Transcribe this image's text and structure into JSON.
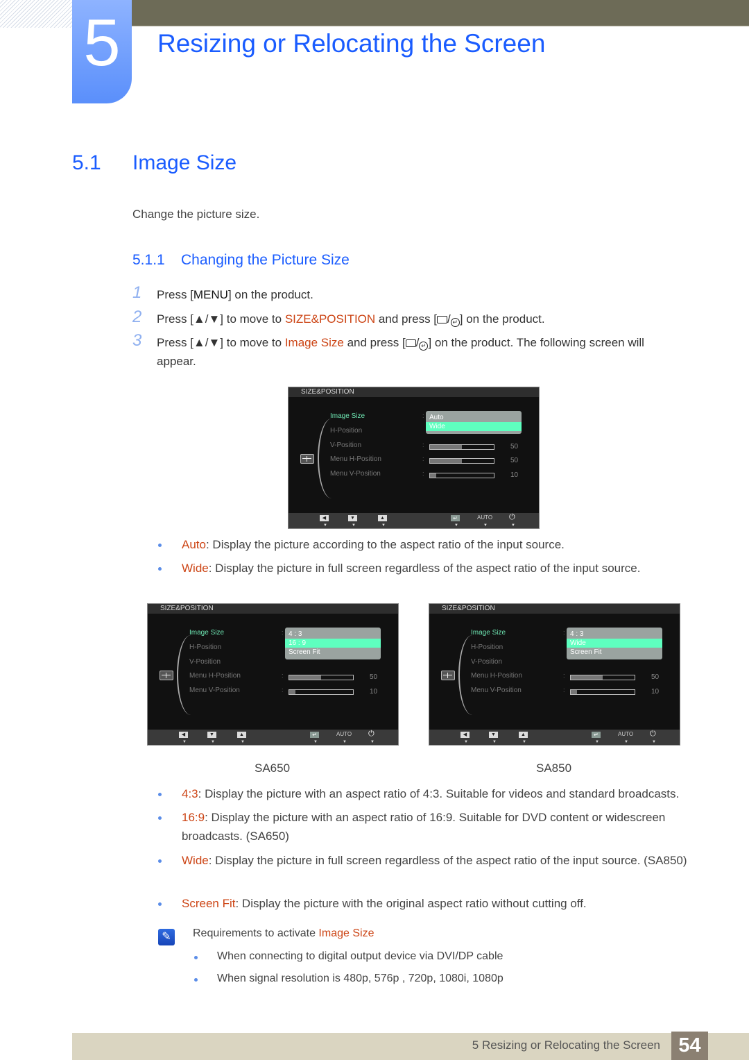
{
  "chapter": {
    "number": "5",
    "title": "Resizing or Relocating the Screen"
  },
  "section": {
    "number": "5.1",
    "title": "Image Size",
    "intro": "Change the picture size."
  },
  "subsection": {
    "number": "5.1.1",
    "title": "Changing the Picture Size"
  },
  "steps": [
    {
      "num": "1",
      "pre": "Press [",
      "key": "MENU",
      "post": "] on the product."
    },
    {
      "num": "2",
      "pre": "Press [▲/▼] to move to ",
      "target": "SIZE&POSITION",
      "mid": " and press [",
      "post": "] on the product."
    },
    {
      "num": "3",
      "pre": "Press [▲/▼] to move to ",
      "target": "Image Size",
      "mid": " and press [",
      "post": "] on the product. The following screen will appear."
    }
  ],
  "osd_screens": [
    {
      "id": "main",
      "header": "SIZE&POSITION",
      "items": [
        "Image Size",
        "H-Position",
        "V-Position",
        "Menu H-Position",
        "Menu V-Position"
      ],
      "options": [
        "Auto",
        "Wide"
      ],
      "selected_option": "Wide",
      "sliders": [
        {
          "label": "V-Position",
          "value": "50",
          "fraction": 0.5
        },
        {
          "label": "Menu H-Position",
          "value": "50",
          "fraction": 0.5
        },
        {
          "label": "Menu V-Position",
          "value": "10",
          "fraction": 0.1
        }
      ],
      "footer": {
        "auto_label": "AUTO"
      }
    },
    {
      "id": "sa650",
      "header": "SIZE&POSITION",
      "items": [
        "Image Size",
        "H-Position",
        "V-Position",
        "Menu H-Position",
        "Menu V-Position"
      ],
      "options": [
        "4 : 3",
        "16 : 9",
        "Screen Fit"
      ],
      "selected_option": "16 : 9",
      "sliders": [
        {
          "label": "Menu H-Position",
          "value": "50",
          "fraction": 0.5
        },
        {
          "label": "Menu V-Position",
          "value": "10",
          "fraction": 0.1
        }
      ],
      "footer": {
        "auto_label": "AUTO"
      },
      "caption": "SA650"
    },
    {
      "id": "sa850",
      "header": "SIZE&POSITION",
      "items": [
        "Image Size",
        "H-Position",
        "V-Position",
        "Menu H-Position",
        "Menu V-Position"
      ],
      "options": [
        "4 : 3",
        "Wide",
        "Screen Fit"
      ],
      "selected_option": "Wide",
      "sliders": [
        {
          "label": "Menu H-Position",
          "value": "50",
          "fraction": 0.5
        },
        {
          "label": "Menu V-Position",
          "value": "10",
          "fraction": 0.1
        }
      ],
      "footer": {
        "auto_label": "AUTO"
      },
      "caption": "SA850"
    }
  ],
  "bullets_main": [
    {
      "term": "Auto",
      "desc": ": Display the picture according to the aspect ratio of the input source."
    },
    {
      "term": "Wide",
      "desc": ": Display the picture in full screen regardless of the aspect ratio of the input source."
    }
  ],
  "bullets_models": [
    {
      "term": "4:3",
      "desc": ": Display the picture with an aspect ratio of 4:3. Suitable for videos and standard broadcasts."
    },
    {
      "term": "16:9",
      "desc": ": Display the picture with an aspect ratio of 16:9. Suitable for DVD content or widescreen broadcasts. (SA650)"
    },
    {
      "term": "Wide",
      "desc": ": Display the picture in full screen regardless of the aspect ratio of the input source. (SA850)"
    },
    {
      "term": "Screen Fit",
      "desc": ": Display the picture with the original aspect ratio without cutting off."
    }
  ],
  "note": {
    "title_pre": "Requirements to activate ",
    "title_hl": "Image Size",
    "items": [
      "When connecting to digital output device via DVI/DP cable",
      "When signal resolution is 480p, 576p , 720p, 1080i, 1080p"
    ]
  },
  "footer": {
    "text": "5 Resizing or Relocating the Screen",
    "page": "54"
  },
  "colors": {
    "heading_blue": "#1a5cff",
    "highlight_orange": "#cc4414",
    "osd_selected": "#5effbf"
  }
}
